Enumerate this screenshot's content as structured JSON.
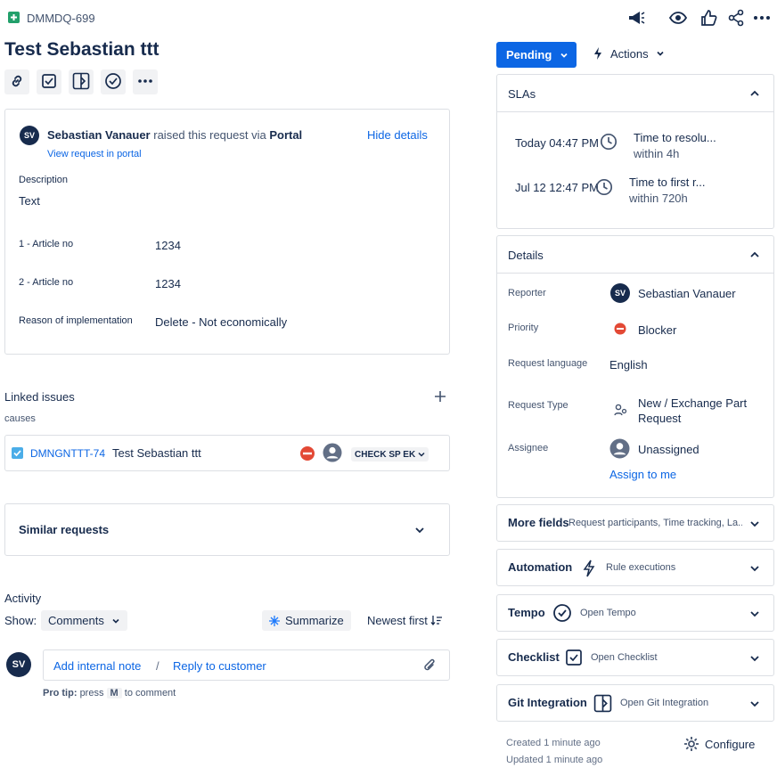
{
  "header": {
    "issue_key": "DMMDQ-699",
    "title": "Test Sebastian ttt"
  },
  "status": {
    "label": "Pending",
    "actions_label": "Actions"
  },
  "request": {
    "avatar_initials": "SV",
    "reporter_name": "Sebastian Vanauer",
    "raised_text": "raised this request via",
    "channel": "Portal",
    "hide_details": "Hide details",
    "view_portal": "View request in portal",
    "description_label": "Description",
    "description_value": "Text",
    "fields": [
      {
        "label": "1 - Article no",
        "value": "1234"
      },
      {
        "label": "2 - Article no",
        "value": "1234"
      },
      {
        "label": "Reason of implementation",
        "value": "Delete - Not economically"
      }
    ]
  },
  "linked": {
    "title": "Linked issues",
    "relation": "causes",
    "item": {
      "key": "DMNGNTTT-74",
      "summary": "Test Sebastian ttt",
      "status": "CHECK SP EK"
    }
  },
  "similar": {
    "title": "Similar requests"
  },
  "activity": {
    "title": "Activity",
    "show_label": "Show:",
    "filter": "Comments",
    "summarize": "Summarize",
    "sort": "Newest first",
    "avatar_initials": "SV",
    "add_note": "Add internal note",
    "separator": "/",
    "reply": "Reply to customer",
    "protip_bold": "Pro tip:",
    "protip_press": "press",
    "protip_key": "M",
    "protip_rest": "to comment"
  },
  "slas": {
    "title": "SLAs",
    "items": [
      {
        "time": "Today 04:47 PM",
        "name": "Time to resolu...",
        "limit": "within 4h"
      },
      {
        "time": "Jul 12 12:47 PM",
        "name": "Time to first r...",
        "limit": "within 720h"
      }
    ]
  },
  "details": {
    "title": "Details",
    "reporter_label": "Reporter",
    "reporter_initials": "SV",
    "reporter_value": "Sebastian Vanauer",
    "priority_label": "Priority",
    "priority_value": "Blocker",
    "language_label": "Request language",
    "language_value": "English",
    "type_label": "Request Type",
    "type_value_line1": "New / Exchange Part",
    "type_value_line2": "Request",
    "assignee_label": "Assignee",
    "assignee_value": "Unassigned",
    "assign_to_me": "Assign to me"
  },
  "panels": [
    {
      "title": "More fields",
      "sub": "Request participants, Time tracking, La..."
    },
    {
      "title": "Automation",
      "sub": "Rule executions"
    },
    {
      "title": "Tempo",
      "sub": "Open Tempo"
    },
    {
      "title": "Checklist",
      "sub": "Open Checklist"
    },
    {
      "title": "Git Integration",
      "sub": "Open Git Integration"
    }
  ],
  "footer": {
    "created": "Created 1 minute ago",
    "updated": "Updated 1 minute ago",
    "configure": "Configure"
  },
  "colors": {
    "primary": "#0c66e4",
    "status_bg": "#0c66e4",
    "blocker": "#e34935",
    "issue_type": "#22a06b",
    "text": "#172b4d"
  }
}
